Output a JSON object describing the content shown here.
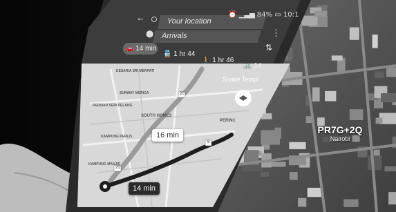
{
  "phone": {
    "status_bar": {
      "battery": "84%",
      "time": "10:1"
    },
    "search": {
      "origin": "Your location",
      "destination": "Arrivals"
    },
    "travel_modes": [
      {
        "icon": "car-icon",
        "label": "14 min",
        "selected": true
      },
      {
        "icon": "train-icon",
        "label": "1 hr 44",
        "selected": false
      },
      {
        "icon": "walk-icon",
        "label": "1 hr 46",
        "selected": false
      },
      {
        "icon": "bike-icon",
        "label": "14",
        "selected": false
      }
    ],
    "map_labels": [
      "DESARIA SRI MERPATI",
      "SUNWAY MERICA",
      "PERSIAR SERI PELANG",
      "SOUTH HOMES",
      "KAMPUNG PERLIS",
      "KAMPUNG MASJID",
      "PERINC",
      "Snake Templ"
    ],
    "route_bubbles": {
      "alternate": "16 min",
      "primary": "14 min"
    },
    "route_shields": [
      "20",
      "20",
      "6"
    ]
  },
  "satellite": {
    "plus_code": "PR7G+2Q",
    "city": "Nairobi"
  },
  "colors": {
    "route": "#1d1d1d",
    "alt_route": "#9a9a9a",
    "map_bg": "#d8d8d8",
    "header": "#3c3c3c"
  }
}
